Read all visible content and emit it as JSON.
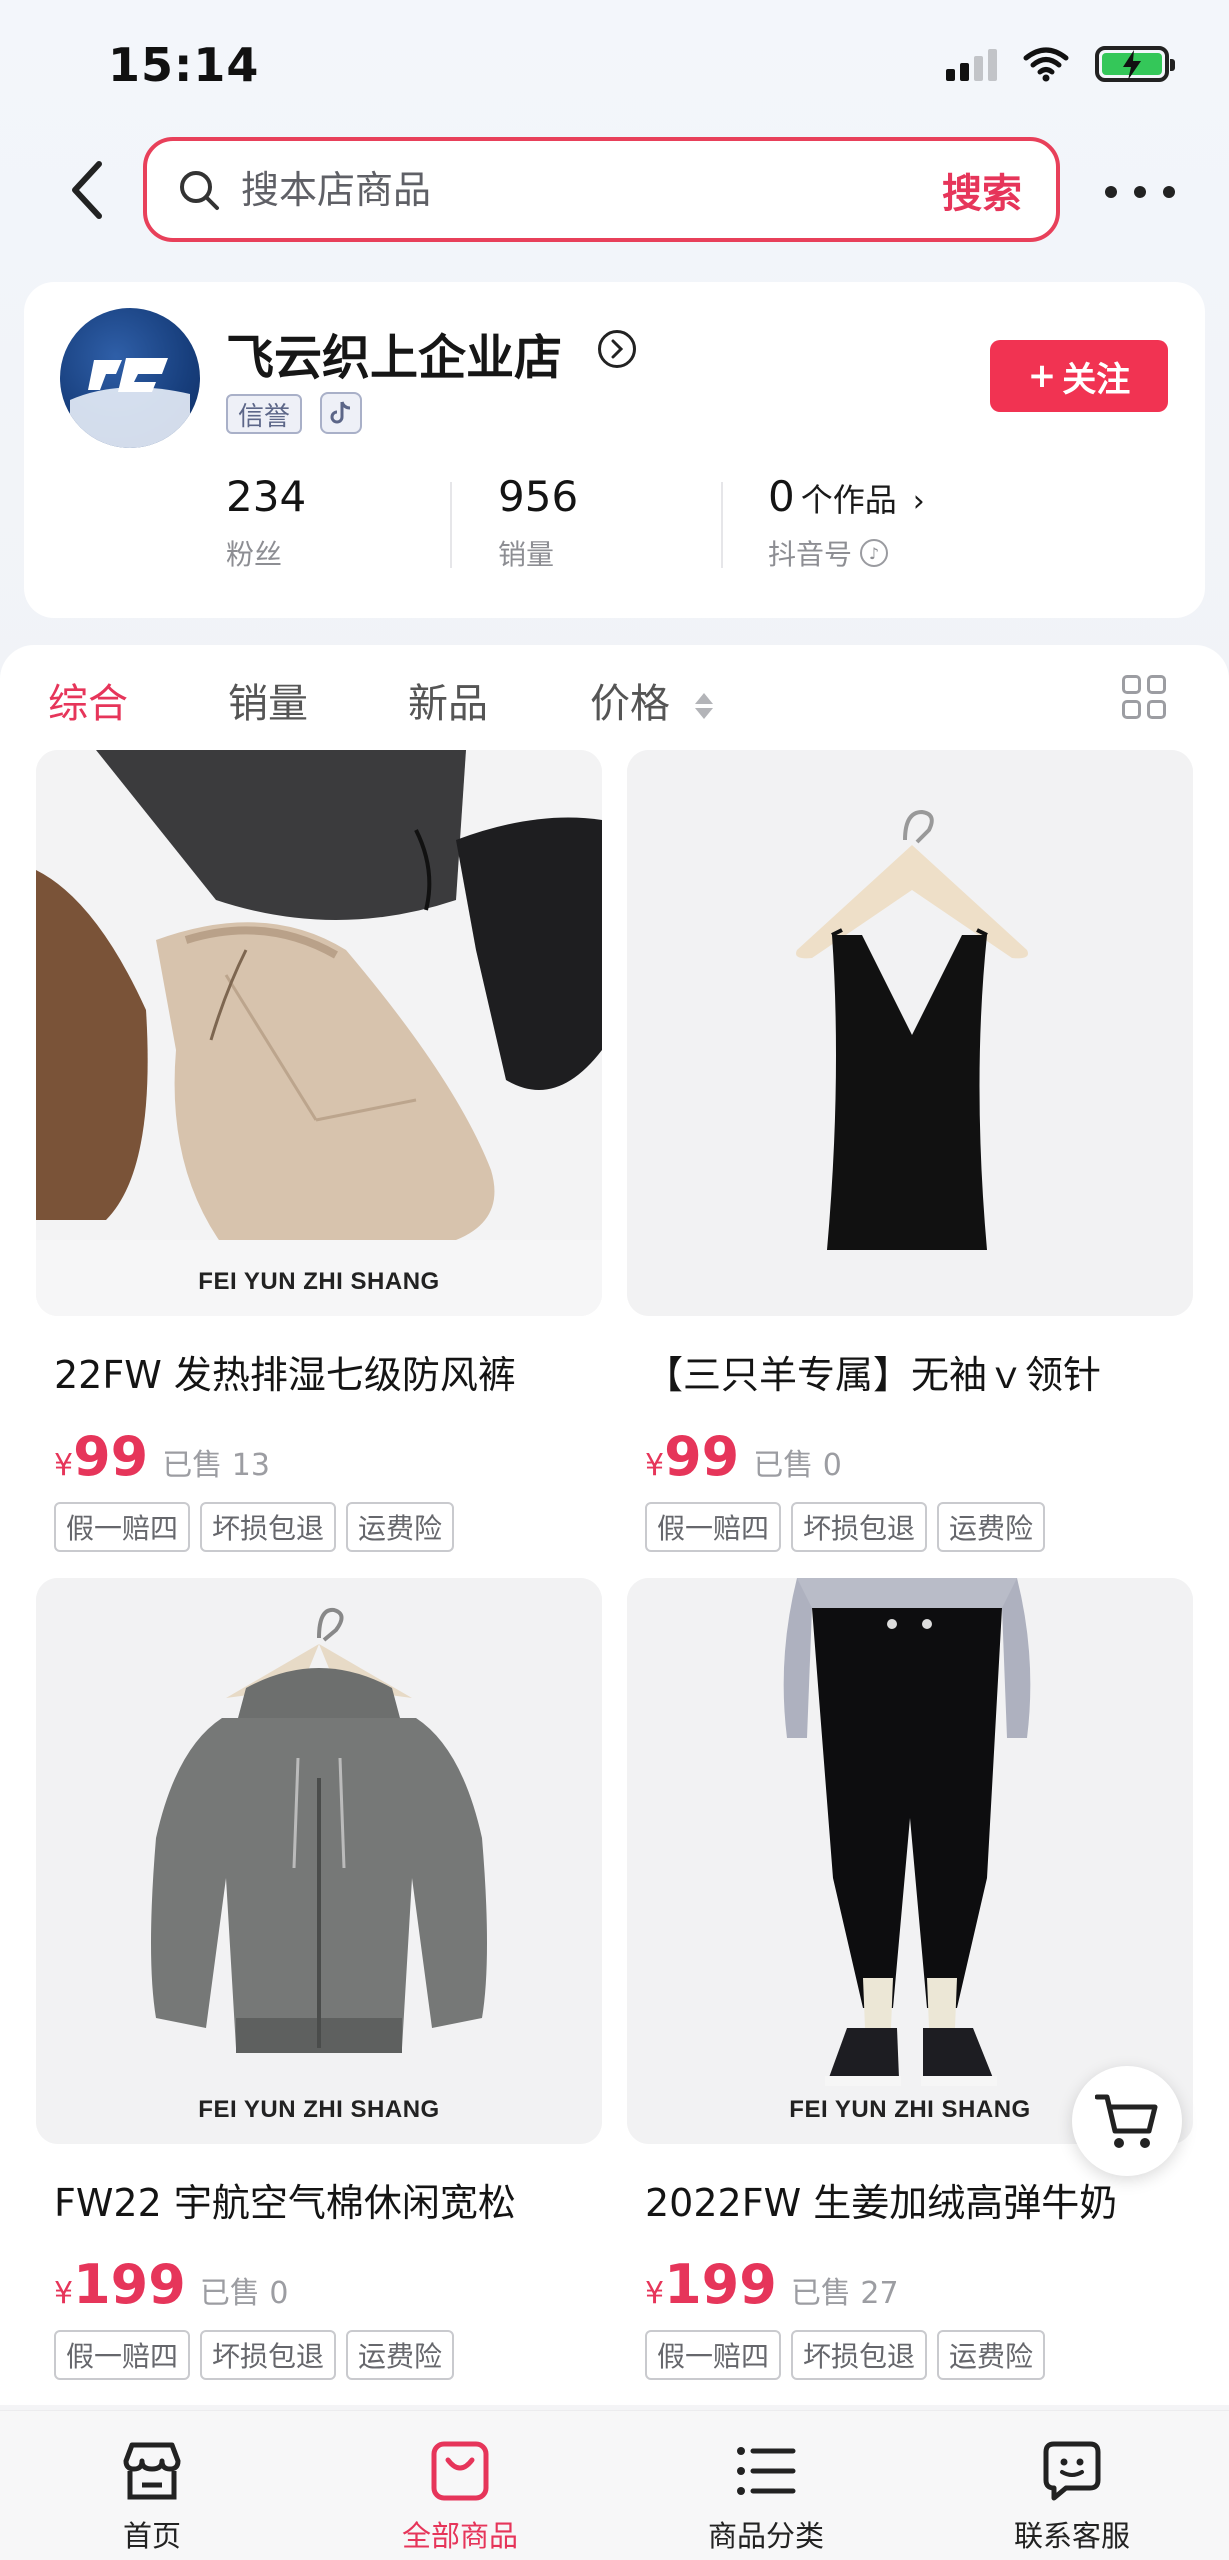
{
  "status_bar": {
    "time": "15:14"
  },
  "search": {
    "placeholder": "搜本店商品",
    "button_label": "搜索"
  },
  "shop": {
    "name": "飞云织上企业店",
    "credit_badge": "信誉",
    "follow_label": "关注",
    "stats": {
      "fans_value": "234",
      "fans_label": "粉丝",
      "sales_value": "956",
      "sales_label": "销量",
      "works_value": "0",
      "works_unit": "个作品",
      "works_label": "抖音号"
    }
  },
  "tabs": [
    {
      "label": "综合",
      "active": true
    },
    {
      "label": "销量",
      "active": false
    },
    {
      "label": "新品",
      "active": false
    },
    {
      "label": "价格",
      "active": false
    }
  ],
  "products": [
    {
      "title": "22FW 发热排湿七级防风裤",
      "currency": "¥",
      "price": "99",
      "sold": "已售 13",
      "tags": [
        "假一赔四",
        "坏损包退",
        "运费险"
      ],
      "caption": "FEI YUN ZHI SHANG",
      "image": "pants-flatlay"
    },
    {
      "title": "【三只羊专属】无袖ｖ领针",
      "currency": "¥",
      "price": "99",
      "sold": "已售 0",
      "tags": [
        "假一赔四",
        "坏损包退",
        "运费险"
      ],
      "caption": "",
      "image": "camisole-on-hanger"
    },
    {
      "title": "FW22 宇航空气棉休闲宽松",
      "currency": "¥",
      "price": "199",
      "sold": "已售 0",
      "tags": [
        "假一赔四",
        "坏损包退",
        "运费险"
      ],
      "caption": "FEI YUN ZHI SHANG",
      "image": "hoodie-jacket-on-hanger"
    },
    {
      "title": "2022FW 生姜加绒高弹牛奶",
      "currency": "¥",
      "price": "199",
      "sold": "已售 27",
      "tags": [
        "假一赔四",
        "坏损包退",
        "运费险"
      ],
      "caption": "FEI YUN ZHI SHANG",
      "image": "leggings-model"
    }
  ],
  "bottom_nav": [
    {
      "label": "首页",
      "icon": "store-icon",
      "active": false
    },
    {
      "label": "全部商品",
      "icon": "bag-icon",
      "active": true
    },
    {
      "label": "商品分类",
      "icon": "list-icon",
      "active": false
    },
    {
      "label": "联系客服",
      "icon": "chat-icon",
      "active": false
    }
  ],
  "colors": {
    "accent": "#e6355a",
    "follow_button": "#f13352"
  }
}
